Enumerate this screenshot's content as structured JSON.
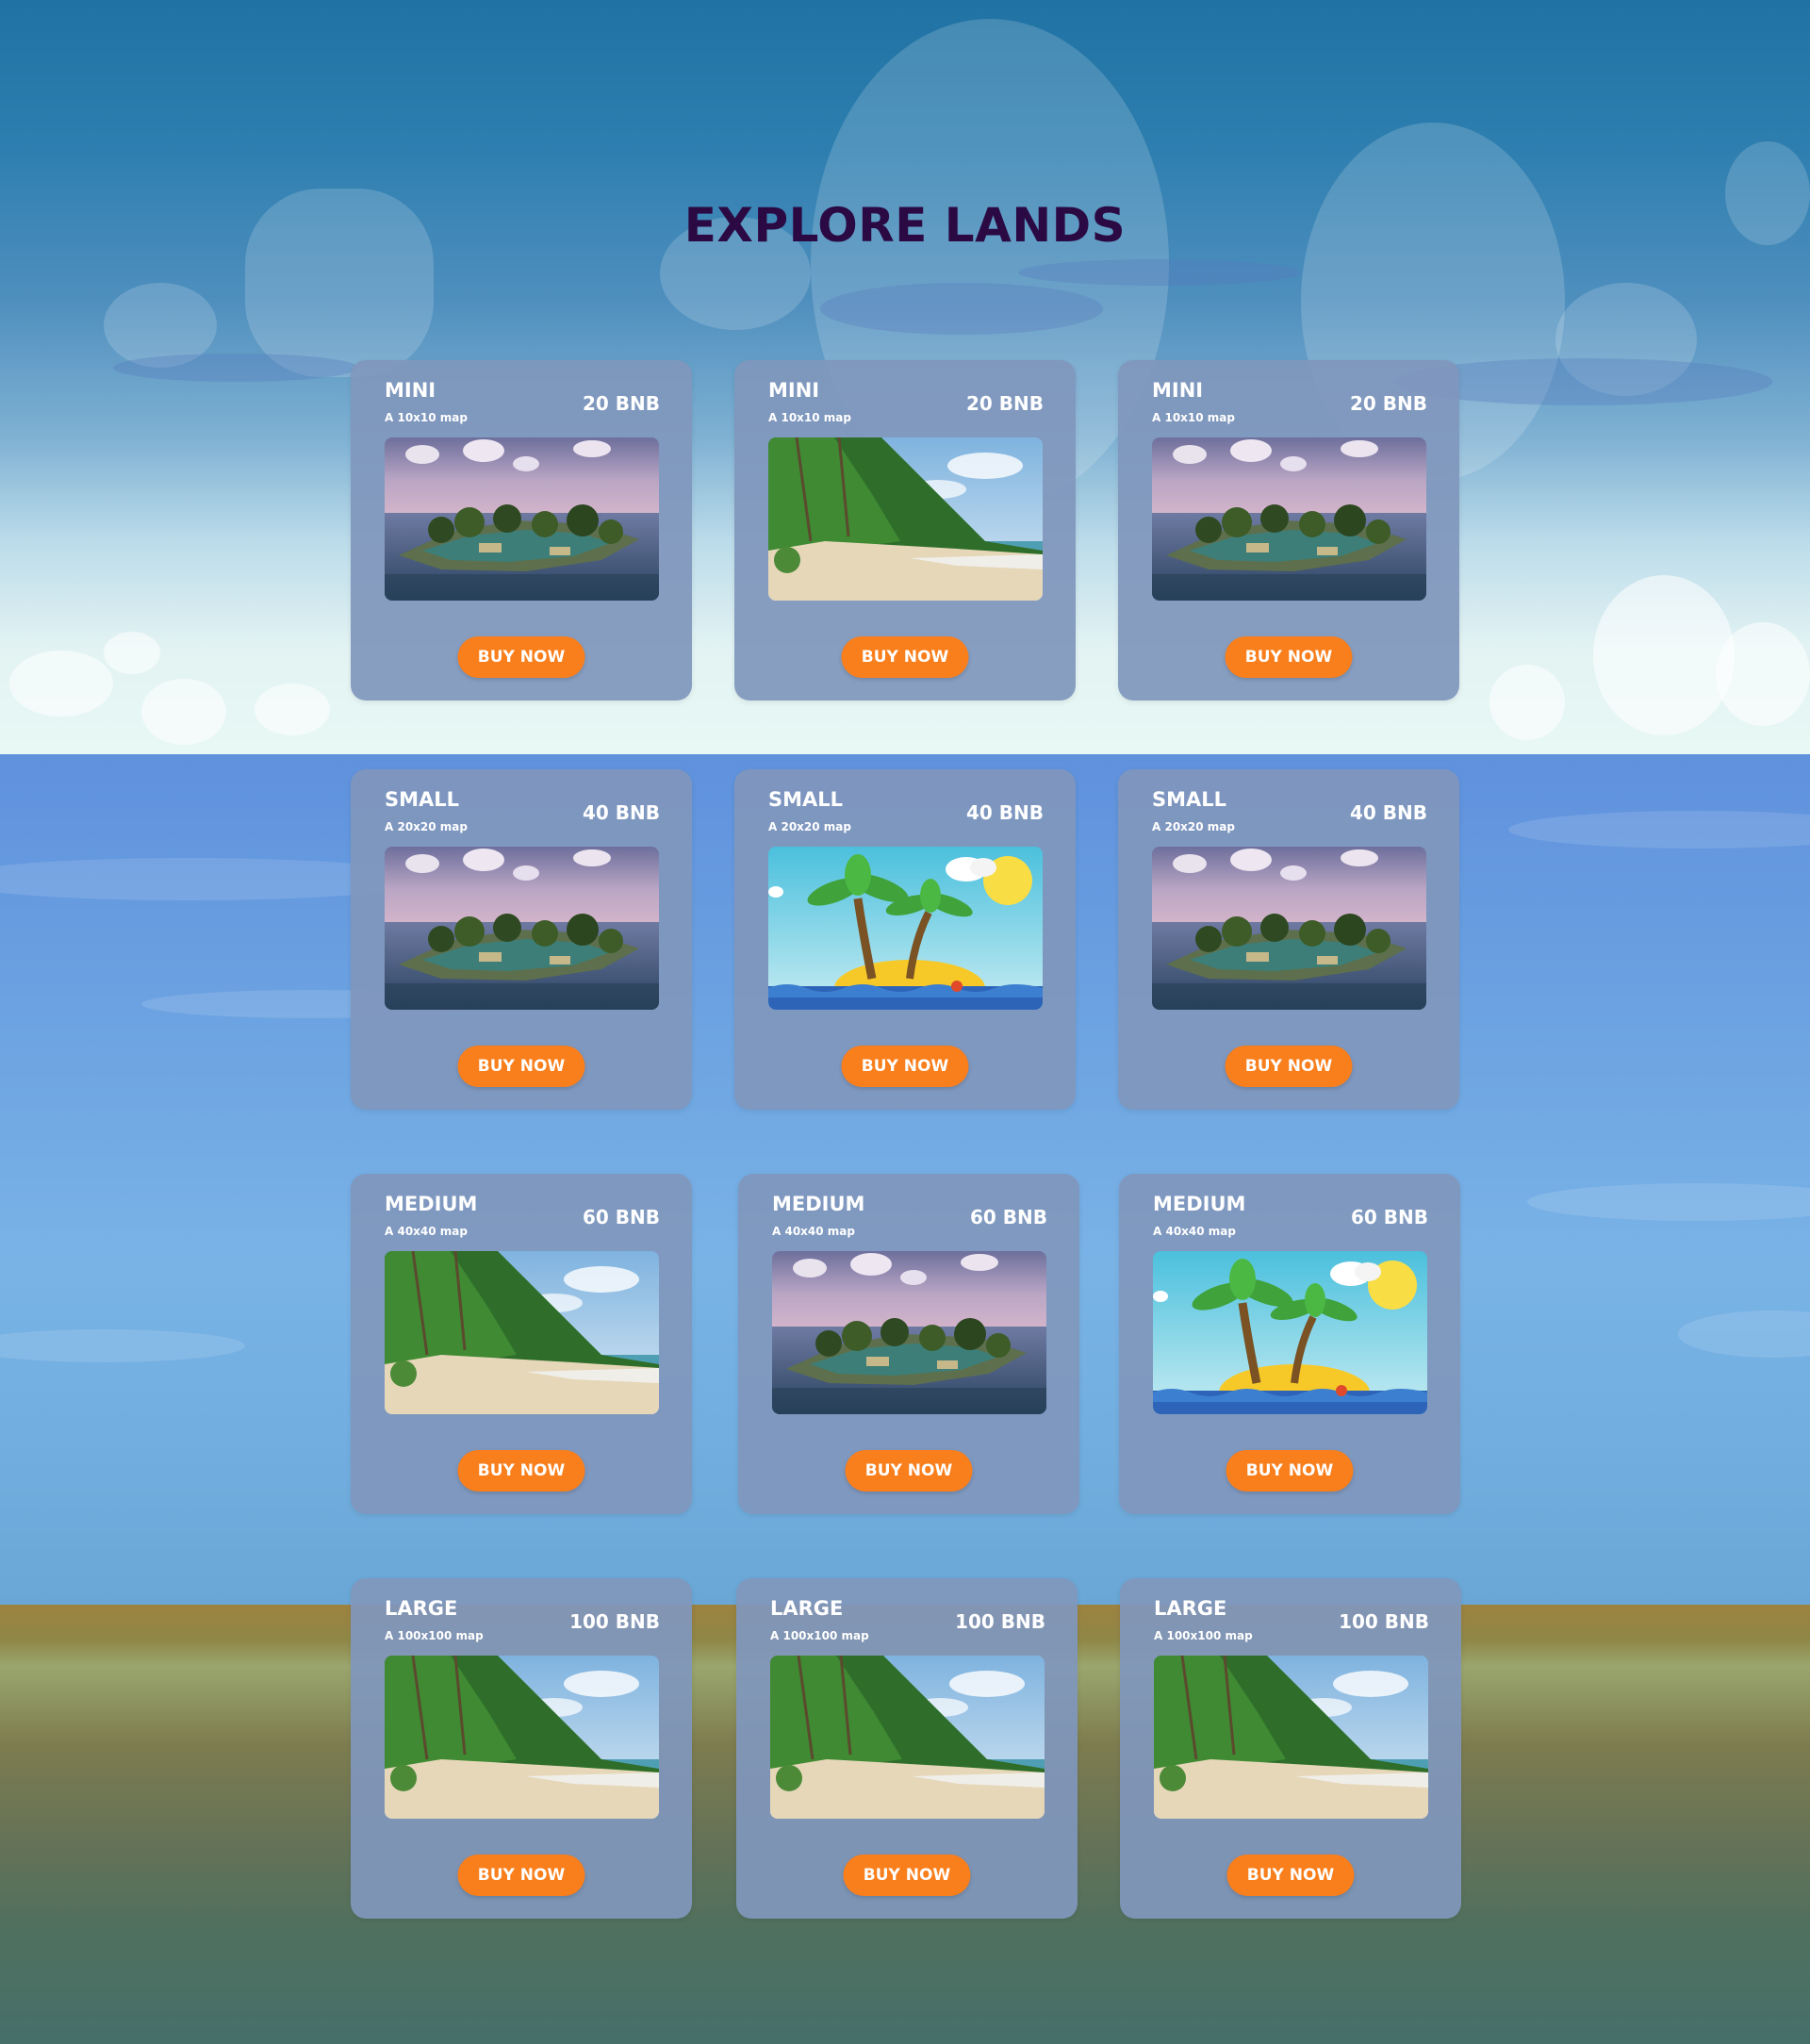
{
  "page": {
    "title": "EXPLORE LANDS"
  },
  "cards": [
    {
      "name": "MINI",
      "desc": "A 10x10 map",
      "price": "20 BNB",
      "button": "BUY NOW",
      "image": "voxel-island"
    },
    {
      "name": "MINI",
      "desc": "A 10x10 map",
      "price": "20 BNB",
      "button": "BUY NOW",
      "image": "palm-beach"
    },
    {
      "name": "MINI",
      "desc": "A 10x10 map",
      "price": "20 BNB",
      "button": "BUY NOW",
      "image": "voxel-island"
    },
    {
      "name": "SMALL",
      "desc": "A 20x20 map",
      "price": "40 BNB",
      "button": "BUY NOW",
      "image": "voxel-island"
    },
    {
      "name": "SMALL",
      "desc": "A 20x20 map",
      "price": "40 BNB",
      "button": "BUY NOW",
      "image": "cartoon-palm-island"
    },
    {
      "name": "SMALL",
      "desc": "A 20x20 map",
      "price": "40 BNB",
      "button": "BUY NOW",
      "image": "voxel-island"
    },
    {
      "name": "MEDIUM",
      "desc": "A 40x40 map",
      "price": "60 BNB",
      "button": "BUY NOW",
      "image": "palm-beach"
    },
    {
      "name": "MEDIUM",
      "desc": "A 40x40 map",
      "price": "60 BNB",
      "button": "BUY NOW",
      "image": "voxel-island"
    },
    {
      "name": "MEDIUM",
      "desc": "A 40x40 map",
      "price": "60 BNB",
      "button": "BUY NOW",
      "image": "cartoon-palm-island"
    },
    {
      "name": "LARGE",
      "desc": "A 100x100 map",
      "price": "100 BNB",
      "button": "BUY NOW",
      "image": "palm-beach"
    },
    {
      "name": "LARGE",
      "desc": "A 100x100 map",
      "price": "100 BNB",
      "button": "BUY NOW",
      "image": "palm-beach"
    },
    {
      "name": "LARGE",
      "desc": "A 100x100 map",
      "price": "100 BNB",
      "button": "BUY NOW",
      "image": "palm-beach"
    }
  ],
  "colors": {
    "title": "#2b0a44",
    "button": "#f97f1d",
    "card": "#8097bc",
    "sky_top": "#1f72a3",
    "sea": "#6ea5e2",
    "ground": "#4f705f"
  }
}
